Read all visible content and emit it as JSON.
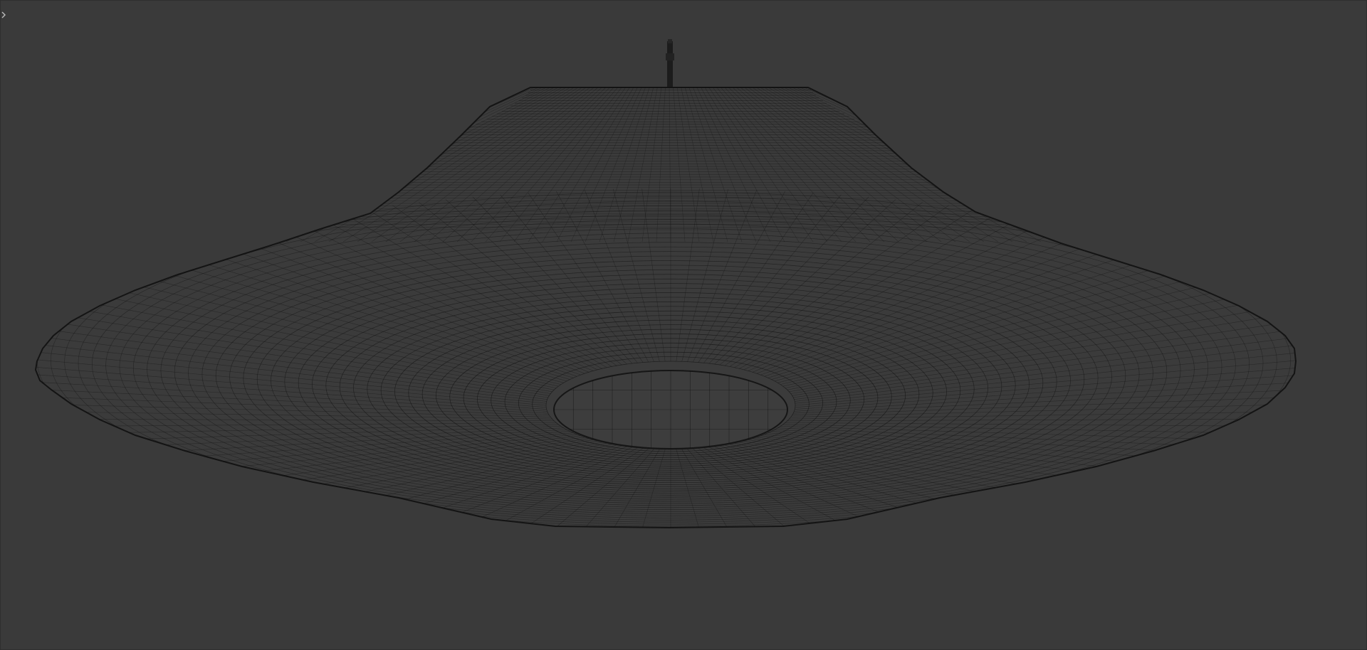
{
  "viewport": {
    "background": "#3a3a3a",
    "shading": "wireframe",
    "view": "front-perspective"
  },
  "object": {
    "type": "saucer-shaped mesh",
    "wire_color": "#111111",
    "fill_color": "#3b3b3b",
    "hole_fill_color": "#3d3d3d"
  },
  "toolbar_toggle": {
    "icon": "chevron-right-icon"
  }
}
